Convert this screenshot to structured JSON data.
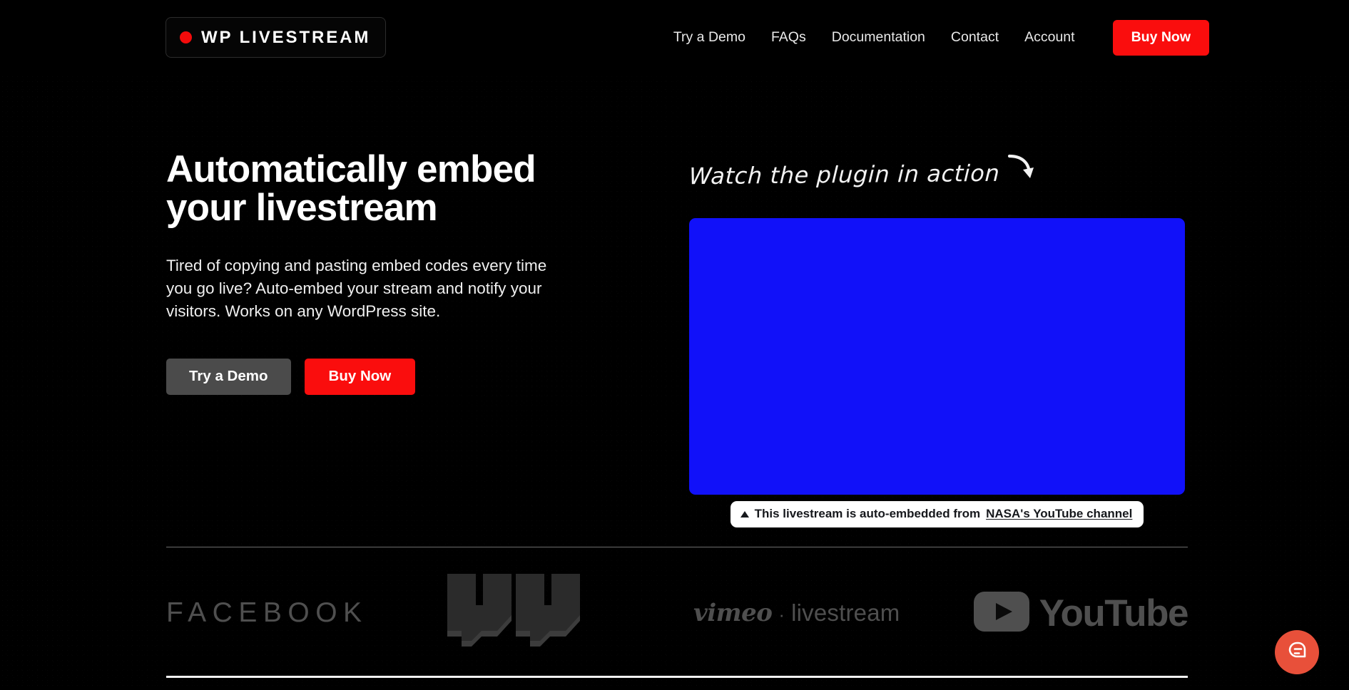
{
  "header": {
    "logo": {
      "text": "WP LIVESTREAM",
      "dot_icon": "record-dot-icon",
      "dot_color": "#f40b0b"
    },
    "nav": [
      {
        "label": "Try a Demo"
      },
      {
        "label": "FAQs"
      },
      {
        "label": "Documentation"
      },
      {
        "label": "Contact"
      },
      {
        "label": "Account"
      }
    ],
    "buy_label": "Buy Now",
    "buy_color": "#fa0d0d"
  },
  "hero": {
    "headline": "Automatically embed\nyour livestream",
    "subcopy": "Tired of copying and pasting embed codes every time you go live? Auto-embed your stream and notify your visitors. Works on any WordPress site.",
    "cta_demo": "Try a Demo",
    "cta_buy": "Buy Now",
    "cta_demo_color": "#4b4b4b",
    "cta_buy_color": "#fa0d0d"
  },
  "preview": {
    "annotation": "Watch the plugin in action",
    "arrow_icon": "curved-arrow-down-right-icon",
    "player_color": "#1111f9",
    "caption_prefix": "This livestream is auto-embedded from",
    "caption_link": "NASA's YouTube channel",
    "caption_marker_icon": "triangle-up-icon"
  },
  "brands": [
    {
      "name": "facebook",
      "label": "FACEBOOK"
    },
    {
      "name": "twitch",
      "label": "twitch"
    },
    {
      "name": "vimeo",
      "label": "vimeo",
      "separator": "·",
      "sublabel": "livestream"
    },
    {
      "name": "youtube",
      "label": "YouTube",
      "icon": "youtube-play-icon"
    }
  ],
  "widget": {
    "chat_icon": "chat-bubble-icon",
    "color": "#e8503a"
  }
}
